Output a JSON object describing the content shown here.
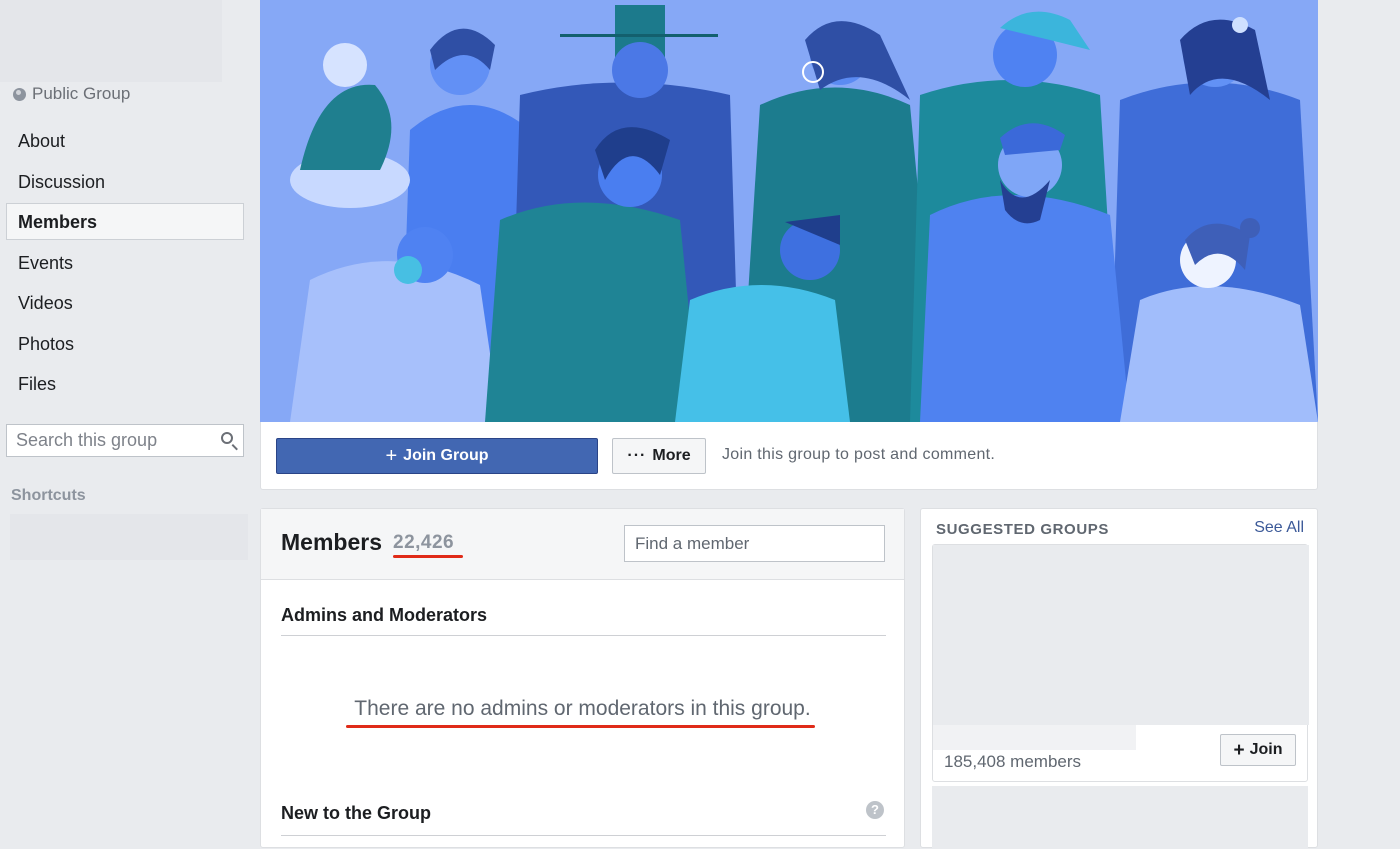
{
  "sidebar": {
    "privacy_label": "Public Group",
    "nav": [
      {
        "label": "About",
        "active": false
      },
      {
        "label": "Discussion",
        "active": false
      },
      {
        "label": "Members",
        "active": true
      },
      {
        "label": "Events",
        "active": false
      },
      {
        "label": "Videos",
        "active": false
      },
      {
        "label": "Photos",
        "active": false
      },
      {
        "label": "Files",
        "active": false
      }
    ],
    "search_placeholder": "Search this group",
    "shortcuts_label": "Shortcuts"
  },
  "cover": {
    "icon": "community-illustration",
    "accent_color": "#7fa3f5"
  },
  "actions": {
    "join_label": "Join Group",
    "more_label": "More",
    "join_hint": "Join this group to post and comment."
  },
  "members": {
    "title": "Members",
    "count": "22,426",
    "find_placeholder": "Find a member",
    "admins_title": "Admins and Moderators",
    "admins_empty": "There are no admins or moderators in this group.",
    "new_title": "New to the Group",
    "help_icon": "?"
  },
  "suggested": {
    "title": "SUGGESTED GROUPS",
    "see_all": "See All",
    "groups": [
      {
        "members": "185,408 members",
        "join_label": "Join"
      }
    ]
  },
  "colors": {
    "brand": "#4267b2",
    "annotation": "#e02b18",
    "link": "#3b5998"
  }
}
